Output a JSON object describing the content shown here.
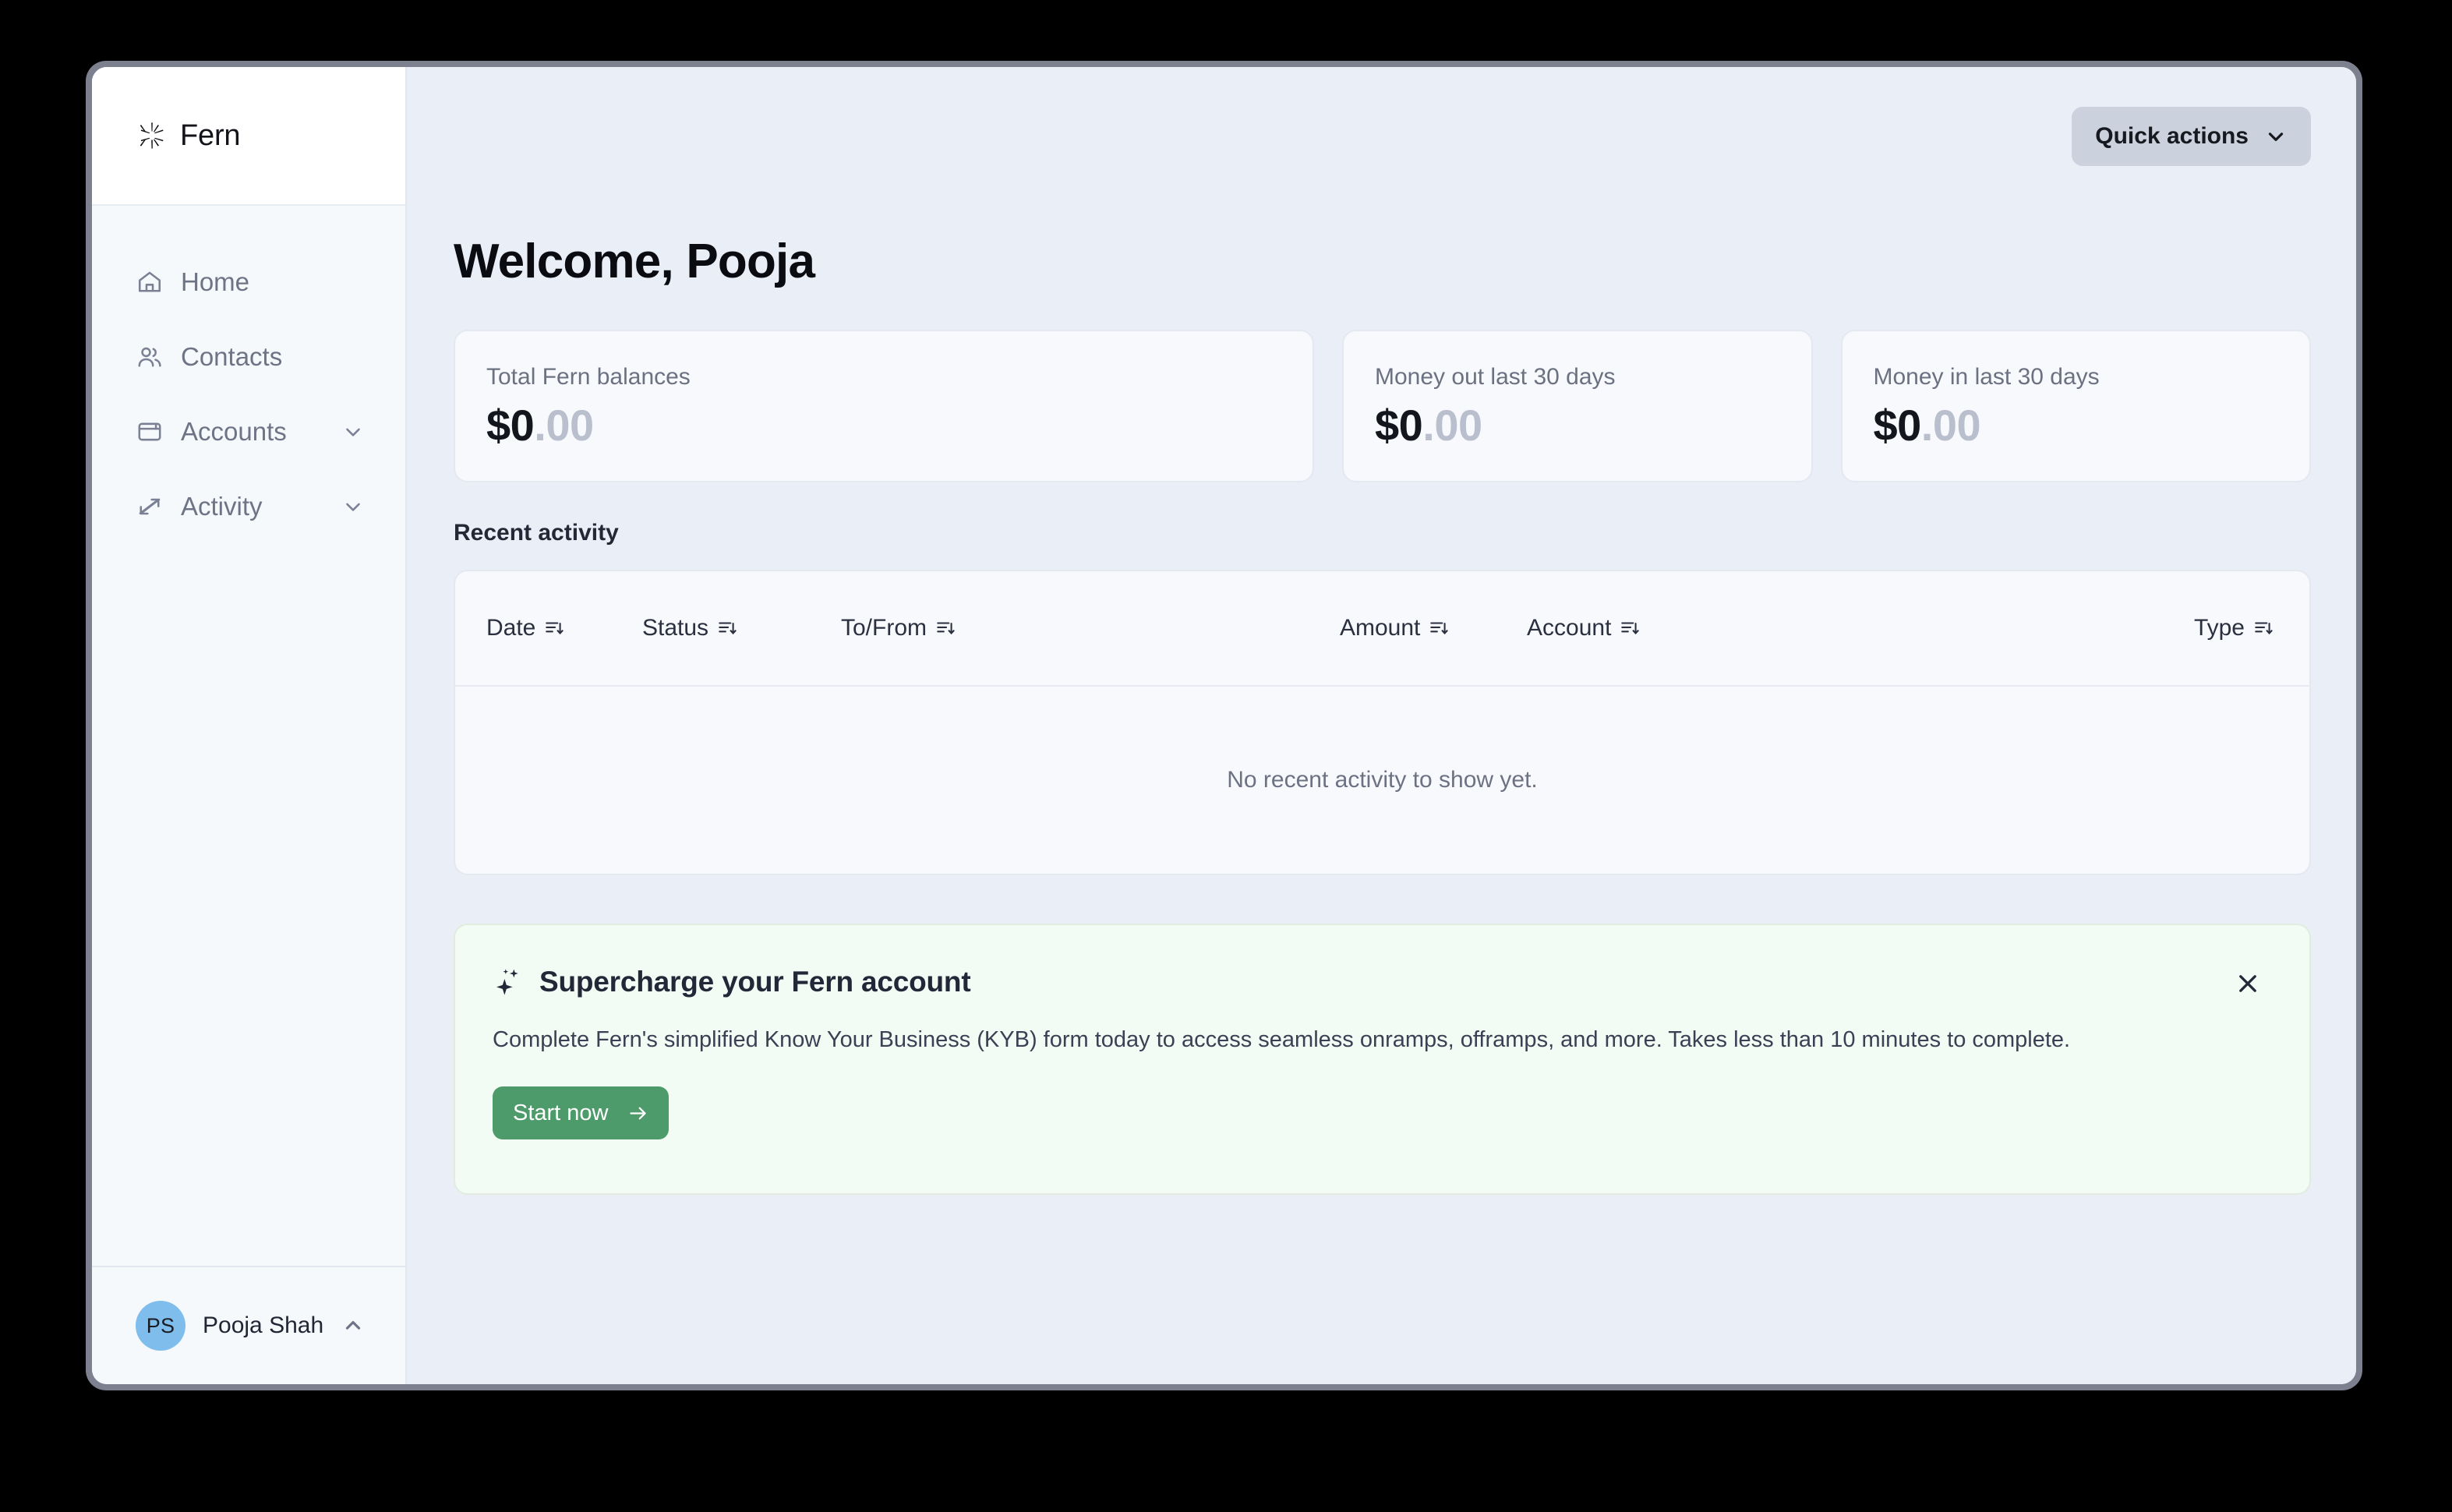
{
  "window": {
    "frame_color": "#7d818f",
    "page_background": "#eaeff7"
  },
  "sidebar": {
    "brand": {
      "name": "Fern",
      "logo_icon": "fern-starburst-logo-icon"
    },
    "items": [
      {
        "label": "Home",
        "icon": "home-icon",
        "expandable": false
      },
      {
        "label": "Contacts",
        "icon": "users-icon",
        "expandable": false
      },
      {
        "label": "Accounts",
        "icon": "wallet-icon",
        "expandable": true,
        "chevron": "chevron-down-icon"
      },
      {
        "label": "Activity",
        "icon": "transfer-arrows-icon",
        "expandable": true,
        "chevron": "chevron-down-icon"
      }
    ],
    "footer": {
      "avatar_initials": "PS",
      "avatar_color": "#7ebdec",
      "user_name": "Pooja Shah",
      "chevron": "chevron-up-icon"
    }
  },
  "topbar": {
    "quick_actions_label": "Quick actions",
    "quick_actions_chevron": "chevron-down-icon"
  },
  "main": {
    "page_title": "Welcome, Pooja",
    "stat_cards": [
      {
        "label": "Total Fern balances",
        "amount_whole": "$0",
        "amount_cents": ".00"
      },
      {
        "label": "Money out last 30 days",
        "amount_whole": "$0",
        "amount_cents": ".00"
      },
      {
        "label": "Money in last 30 days",
        "amount_whole": "$0",
        "amount_cents": ".00"
      }
    ],
    "recent_activity": {
      "title": "Recent activity",
      "columns": [
        {
          "label": "Date",
          "sort_icon": "sort-descending-icon"
        },
        {
          "label": "Status",
          "sort_icon": "sort-descending-icon"
        },
        {
          "label": "To/From",
          "sort_icon": "sort-descending-icon"
        },
        {
          "label": "Amount",
          "sort_icon": "sort-descending-icon"
        },
        {
          "label": "Account",
          "sort_icon": "sort-descending-icon"
        },
        {
          "label": "Type",
          "sort_icon": "sort-descending-icon"
        }
      ],
      "empty_message": "No recent activity to show yet."
    },
    "promo": {
      "icon": "sparkles-icon",
      "title": "Supercharge your Fern account",
      "body": "Complete Fern's simplified Know Your Business (KYB) form today to access seamless onramps, offramps, and more. Takes less than 10 minutes to complete.",
      "button_label": "Start now",
      "button_arrow_icon": "arrow-right-icon",
      "button_color": "#4d9a6a",
      "background_color": "#f3fcf4",
      "close_icon": "close-icon"
    }
  }
}
